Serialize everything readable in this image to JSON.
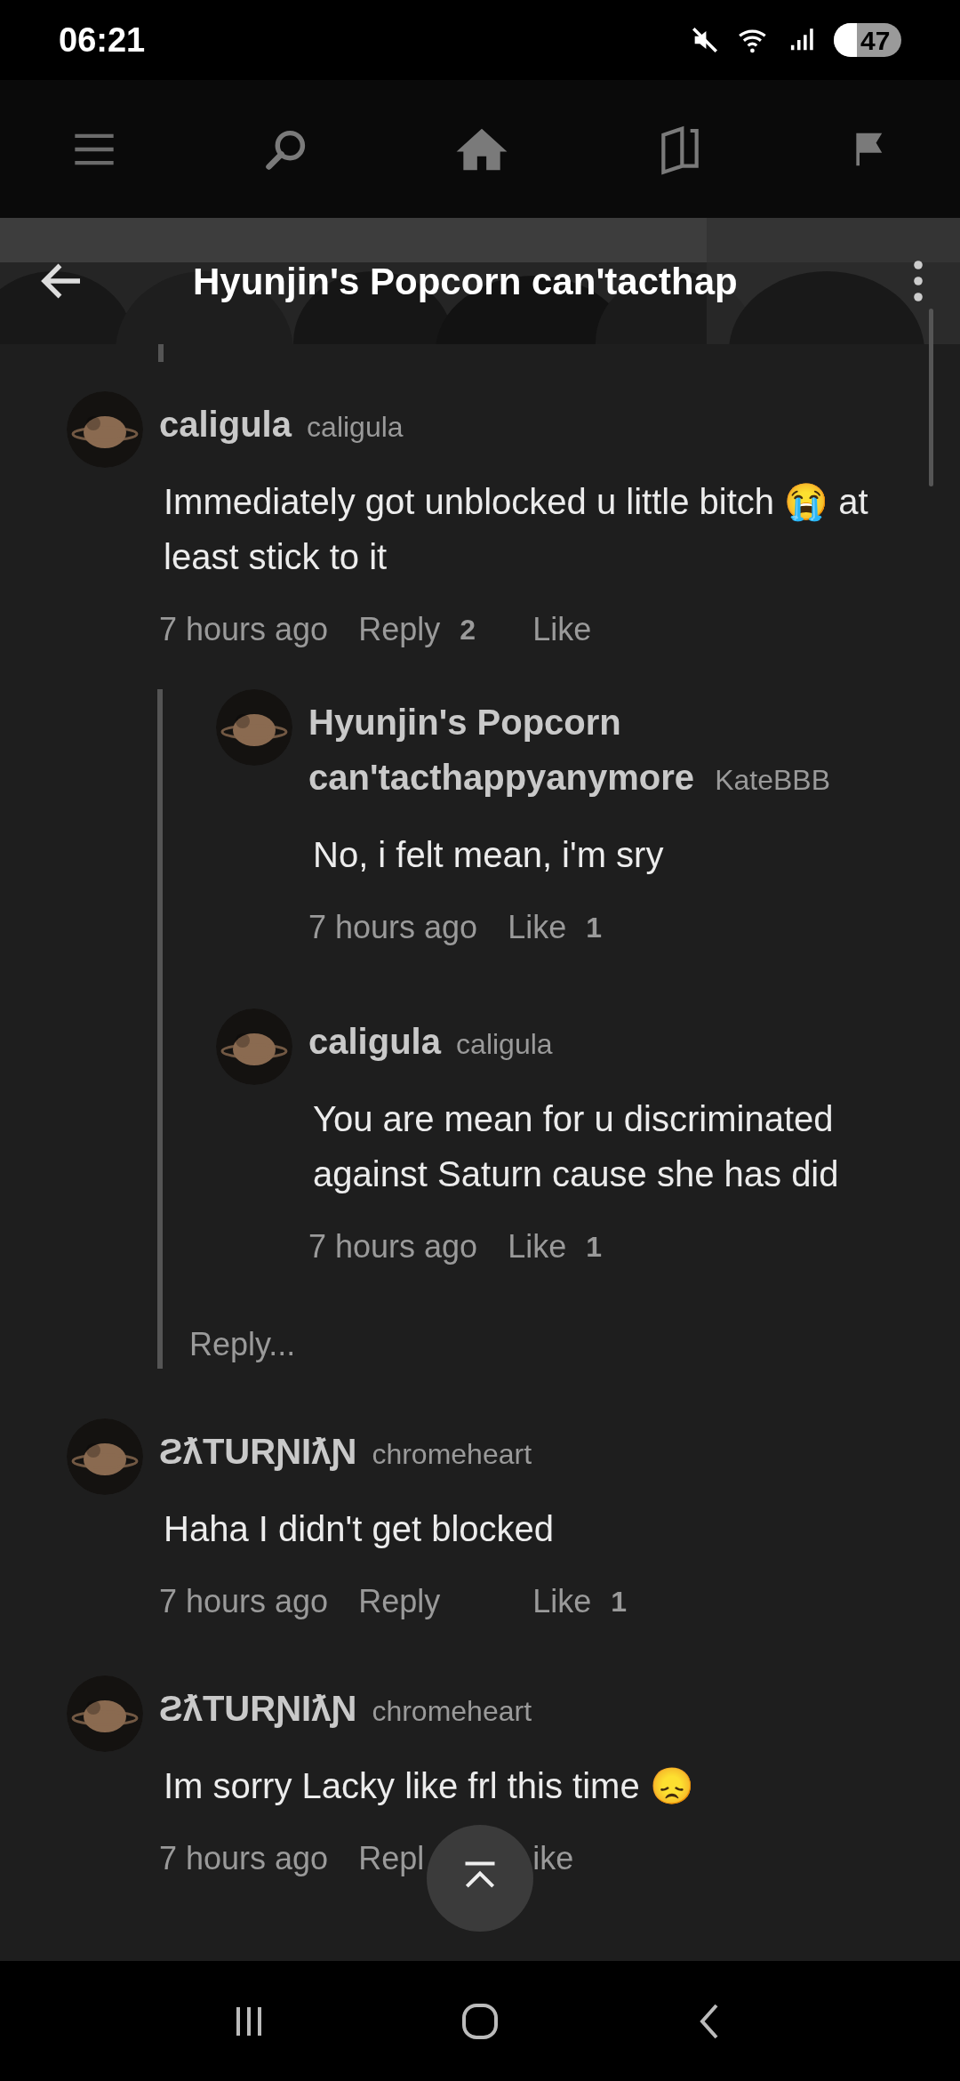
{
  "status_bar": {
    "time": "06:21",
    "battery": "47"
  },
  "header": {
    "title": "Hyunjin's Popcorn can'tacthap"
  },
  "comments": [
    {
      "name": "caligula",
      "handle": "caligula",
      "body": "Immediately got unblocked u little bitch 😭 at least stick to it",
      "actions": [
        {
          "kind": "time",
          "text": "7 hours ago"
        },
        {
          "kind": "reply",
          "text": "Reply",
          "count": "2"
        },
        {
          "kind": "like",
          "text": "Like"
        }
      ],
      "replies": [
        {
          "name": "Hyunjin's Popcorn can'tacthappyanymore",
          "handle": "KateBBB",
          "body": "No, i felt mean, i'm sry",
          "actions": [
            {
              "kind": "time",
              "text": "7 hours ago"
            },
            {
              "kind": "like",
              "text": "Like",
              "count": "1"
            }
          ]
        },
        {
          "name": "caligula",
          "handle": "caligula",
          "body": "You are mean for u discriminated against Saturn cause she has did",
          "actions": [
            {
              "kind": "time",
              "text": "7 hours ago"
            },
            {
              "kind": "like",
              "text": "Like",
              "count": "1"
            }
          ]
        }
      ],
      "reply_prompt": "Reply..."
    },
    {
      "name": "ƧƛTURƝƖƛƝ",
      "handle": "chromeheart",
      "body": "Haha I didn't get blocked",
      "actions": [
        {
          "kind": "time",
          "text": "7 hours ago"
        },
        {
          "kind": "reply",
          "text": "Reply"
        },
        {
          "kind": "like",
          "text": "Like",
          "count": "1"
        }
      ]
    },
    {
      "name": "ƧƛTURƝƖƛƝ",
      "handle": "chromeheart",
      "body": "Im sorry Lacky like frl this time 😞",
      "actions": [
        {
          "kind": "time",
          "text": "7 hours ago"
        },
        {
          "kind": "reply",
          "text": "Repl"
        },
        {
          "kind": "like",
          "text": "ike"
        }
      ]
    }
  ]
}
